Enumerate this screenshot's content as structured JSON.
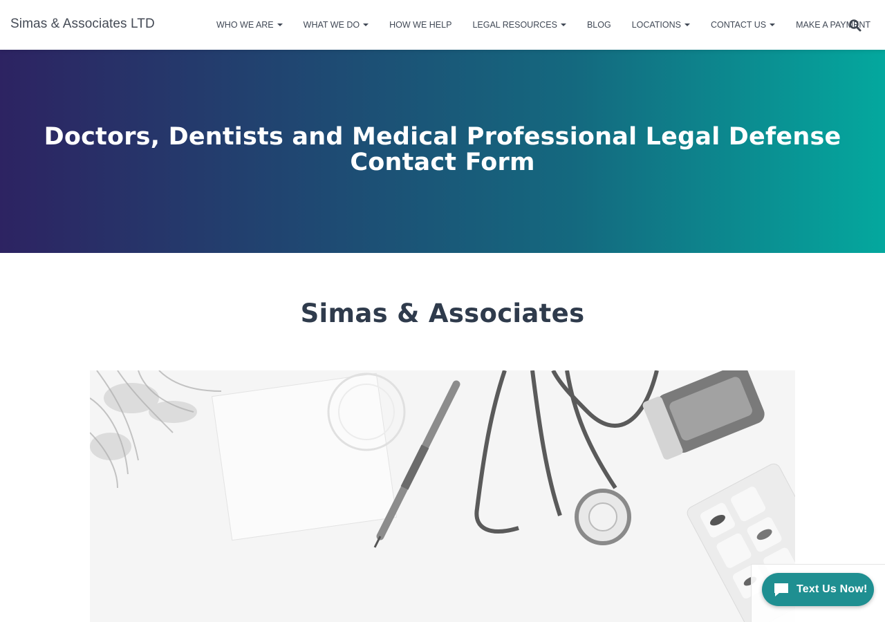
{
  "header": {
    "brand": "Simas & Associates LTD",
    "nav": [
      {
        "label": "WHO WE ARE",
        "dropdown": true
      },
      {
        "label": "WHAT WE DO",
        "dropdown": true
      },
      {
        "label": "HOW WE HELP",
        "dropdown": false
      },
      {
        "label": "LEGAL RESOURCES",
        "dropdown": true
      },
      {
        "label": "BLOG",
        "dropdown": false
      },
      {
        "label": "LOCATIONS",
        "dropdown": true
      },
      {
        "label": "CONTACT US",
        "dropdown": true
      },
      {
        "label": "MAKE A PAYMENT",
        "dropdown": false
      }
    ],
    "search_icon": "search-icon"
  },
  "hero": {
    "title": "Doctors, Dentists and Medical Professional Legal Defense Contact Form",
    "gradient_start": "#2d2362",
    "gradient_end": "#04a89e"
  },
  "main": {
    "section_title": "Simas & Associates"
  },
  "widget": {
    "text_us_label": "Text Us Now!",
    "icon": "chat-bubble-icon",
    "color": "#1f8f91"
  }
}
